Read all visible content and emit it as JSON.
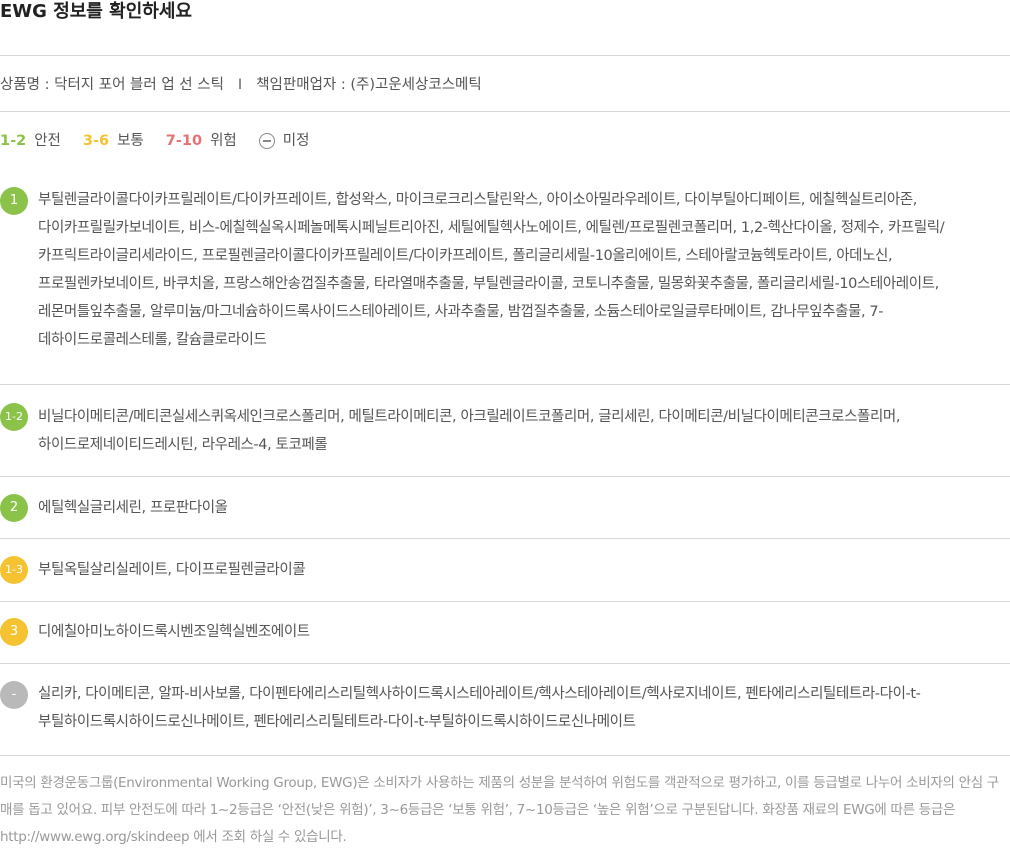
{
  "title": "EWG 정보를 확인하세요",
  "product": {
    "name_label": "상품명 : 닥터지 포어 블러 업 선 스틱",
    "separator": "I",
    "seller_label": "책임판매업자 : (주)고운세상코스메틱"
  },
  "legend": {
    "safe": {
      "range": "1-2",
      "label": "안전",
      "color": "#8bc34a"
    },
    "normal": {
      "range": "3-6",
      "label": "보통",
      "color": "#f5c331"
    },
    "danger": {
      "range": "7-10",
      "label": "위험",
      "color": "#e57373"
    },
    "undetermined": {
      "label": "미정",
      "icon": "minus-circle-icon"
    }
  },
  "groups": [
    {
      "grade": "1",
      "color": "#8bc34a",
      "ingredients": "부틸렌글라이콜다이카프릴레이트/다이카프레이트, 합성왁스, 마이크로크리스탈린왁스, 아이소아밀라우레이트, 다이부틸아디페이트, 에칠헥실트리아존, 다이카프릴릴카보네이트, 비스-에칠헥실옥시페놀메톡시페닐트리아진, 세틸에틸헥사노에이트, 에틸렌/프로필렌코폴리머, 1,2-헥산다이올, 정제수, 카프릴릭/카프릭트라이글리세라이드, 프로필렌글라이콜다이카프릴레이트/다이카프레이트, 폴리글리세릴-10올리에이트, 스테아랄코늄헥토라이트, 아데노신, 프로필렌카보네이트, 바쿠치올, 프랑스해안송껍질추출물, 타라열매추출물, 부틸렌글라이콜, 코토니추출물, 밀몽화꽃추출물, 폴리글리세릴-10스테아레이트, 레몬머틀잎추출물, 알루미늄/마그네슘하이드록사이드스테아레이트, 사과추출물, 밤껍질추출물, 소듐스테아로일글루타메이트, 감나무잎추출물, 7-데하이드로콜레스테롤, 칼슘클로라이드"
    },
    {
      "grade": "1-2",
      "color": "#8bc34a",
      "ingredients": "비닐다이메티콘/메티콘실세스퀴옥세인크로스폴리머, 메틸트라이메티콘, 아크릴레이트코폴리머, 글리세린, 다이메티콘/비닐다이메티콘크로스폴리머, 하이드로제네이티드레시틴, 라우레스-4, 토코페롤"
    },
    {
      "grade": "2",
      "color": "#8bc34a",
      "ingredients": "에틸헥실글리세린, 프로판다이올"
    },
    {
      "grade": "1-3",
      "color": "#f5c331",
      "ingredients": "부틸옥틸살리실레이트, 다이프로필렌글라이콜"
    },
    {
      "grade": "3",
      "color": "#f5c331",
      "ingredients": "디에칠아미노하이드록시벤조일헥실벤조에이트"
    },
    {
      "grade": "-",
      "color": "#b9b9b9",
      "ingredients": "실리카, 다이메티콘, 알파-비사보롤, 다이펜타에리스리틸헥사하이드록시스테아레이트/헥사스테아레이트/헥사로지네이트, 펜타에리스리틸테트라-다이-t-부틸하이드록시하이드로신나메이트, 펜타에리스리틸테트라-다이-t-부틸하이드록시하이드로신나메이트"
    }
  ],
  "footnote": "미국의 환경운동그룹(Environmental Working Group, EWG)은 소비자가 사용하는 제품의 성분을 분석하여 위험도를 객관적으로 평가하고, 이를 등급별로 나누어 소비자의 안심 구매를 돕고 있어요. 피부 안전도에 따라 1~2등급은 ‘안전(낮은 위험)’, 3~6등급은 ‘보통 위험’, 7~10등급은 ‘높은 위험’으로 구분된답니다. 화장품 재료의 EWG에 따른 등급은 http://www.ewg.org/skindeep 에서 조회 하실 수 있습니다."
}
